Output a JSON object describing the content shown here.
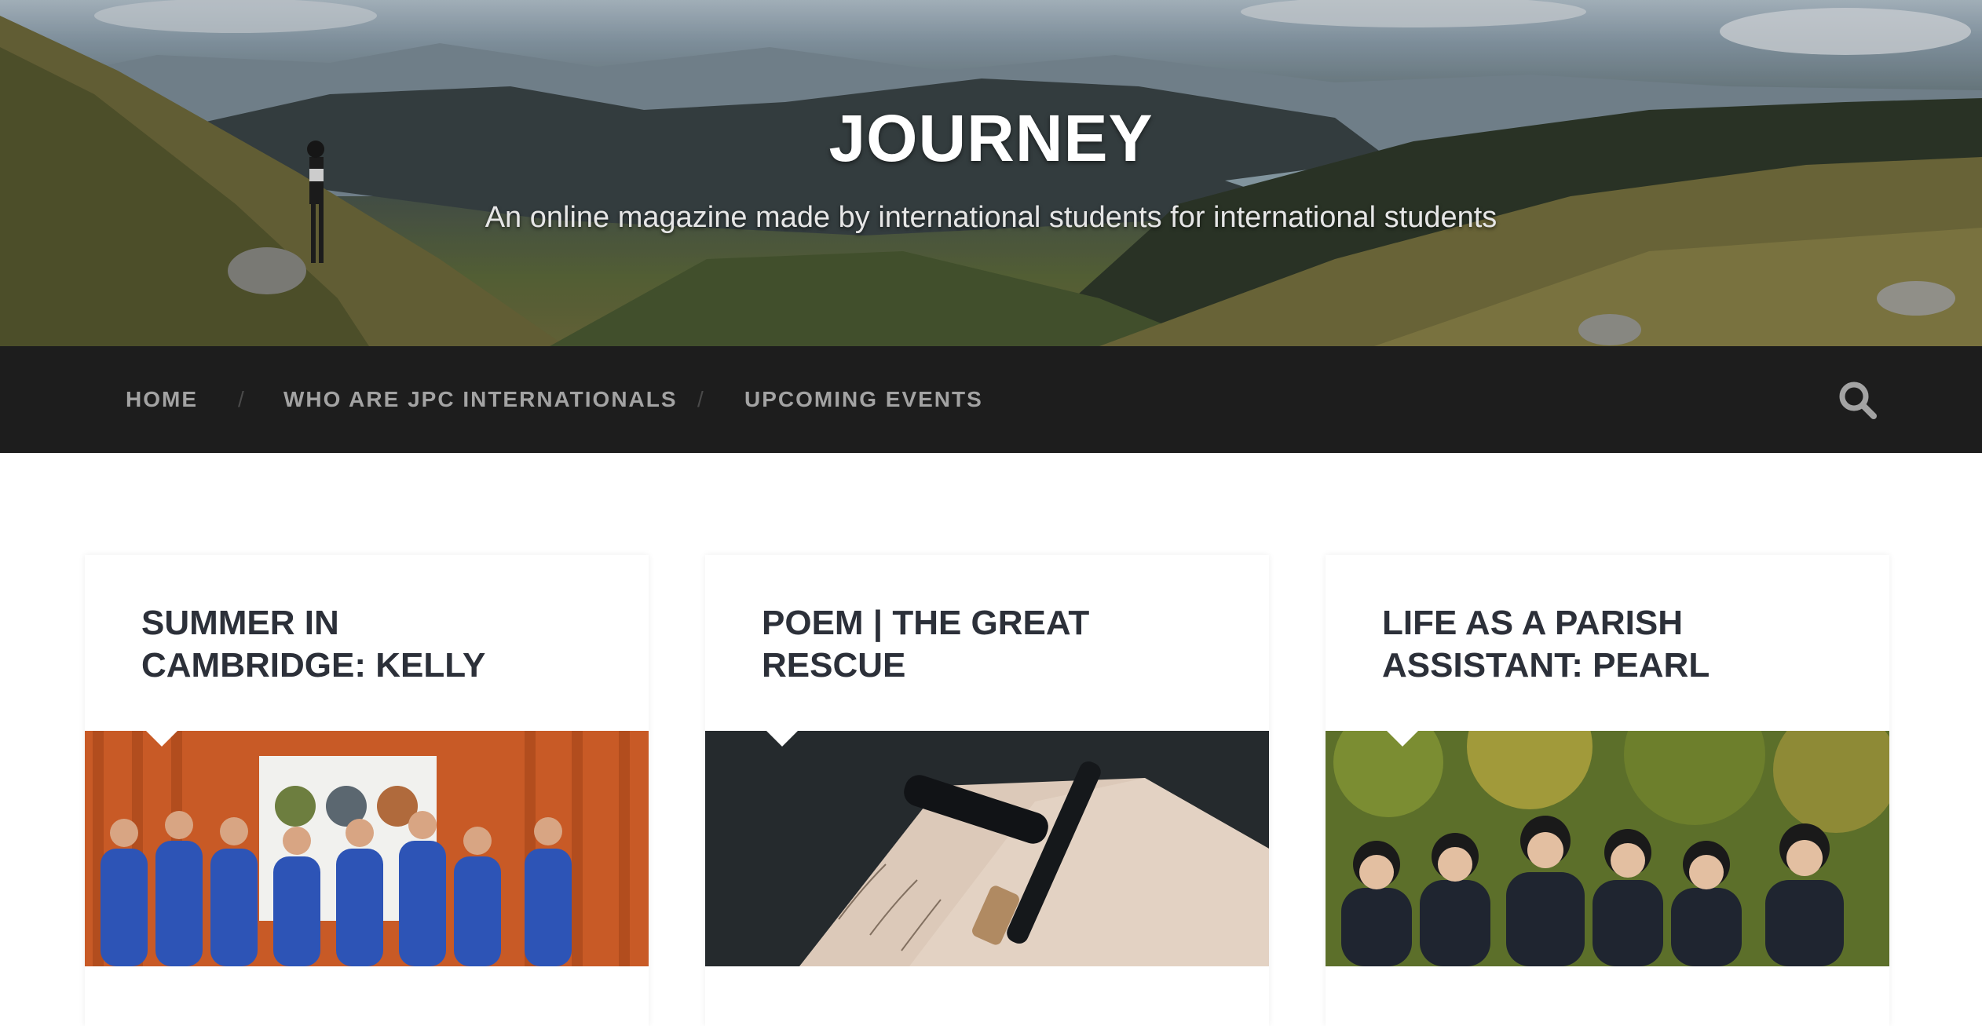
{
  "site": {
    "title": "JOURNEY",
    "tagline": "An online magazine made by international students for international students"
  },
  "nav": {
    "items": [
      {
        "label": "HOME"
      },
      {
        "label": "WHO ARE JPC INTERNATIONALS"
      },
      {
        "label": "UPCOMING EVENTS"
      }
    ],
    "separator": "/",
    "search_icon": "search-icon"
  },
  "posts": [
    {
      "title": "SUMMER IN CAMBRIDGE: KELLY",
      "image": "group-photo-blue-shirts"
    },
    {
      "title": "POEM | THE GREAT RESCUE",
      "image": "fountain-pen-on-notebook"
    },
    {
      "title": "LIFE AS A PARISH ASSISTANT: PEARL",
      "image": "group-photo-in-park"
    }
  ],
  "colors": {
    "nav_bg": "#1d1d1d",
    "nav_text": "#a3a3a3",
    "title_text": "#2c3039",
    "page_bg": "#ffffff"
  }
}
